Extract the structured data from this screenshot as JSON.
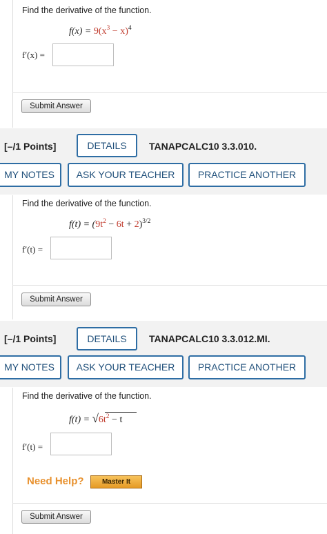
{
  "question1": {
    "prompt": "Find the derivative of the function.",
    "function_lhs": "f(x) = ",
    "function_coef": "9(x",
    "function_exp_inner": "3",
    "function_rest": " − x)",
    "function_power": "4",
    "answer_label": "f′(x) =",
    "answer_value": "",
    "submit_label": "Submit Answer"
  },
  "question2": {
    "header": {
      "points": "[–/1 Points]",
      "details_label": "DETAILS",
      "code": "TANAPCALC10 3.3.010.",
      "my_notes_label": "MY NOTES",
      "ask_teacher_label": "ASK YOUR TEACHER",
      "practice_another_label": "PRACTICE ANOTHER"
    },
    "prompt": "Find the derivative of the function.",
    "function_lhs": "f(t) = (",
    "term1": "9t",
    "term1_exp": "2",
    "op1": " − ",
    "term2": "6t",
    "op2": " + ",
    "term3": "2",
    "close": ")",
    "power": "3/2",
    "answer_label": "f′(t) =",
    "answer_value": "",
    "submit_label": "Submit Answer"
  },
  "question3": {
    "header": {
      "points": "[–/1 Points]",
      "details_label": "DETAILS",
      "code": "TANAPCALC10 3.3.012.MI.",
      "my_notes_label": "MY NOTES",
      "ask_teacher_label": "ASK YOUR TEACHER",
      "practice_another_label": "PRACTICE ANOTHER"
    },
    "prompt": "Find the derivative of the function.",
    "function_lhs": "f(t) = ",
    "radicand": "6t",
    "radicand_exp": "2",
    "radicand_rest": " − t",
    "answer_label": "f′(t) =",
    "answer_value": "",
    "need_help_label": "Need Help?",
    "master_it_label": "Master It",
    "submit_label": "Submit Answer"
  },
  "colors": {
    "accent_blue": "#2e6da4",
    "value_red": "#c0392b",
    "need_help_orange": "#e8912e",
    "band_gray": "#f2f2f2"
  }
}
